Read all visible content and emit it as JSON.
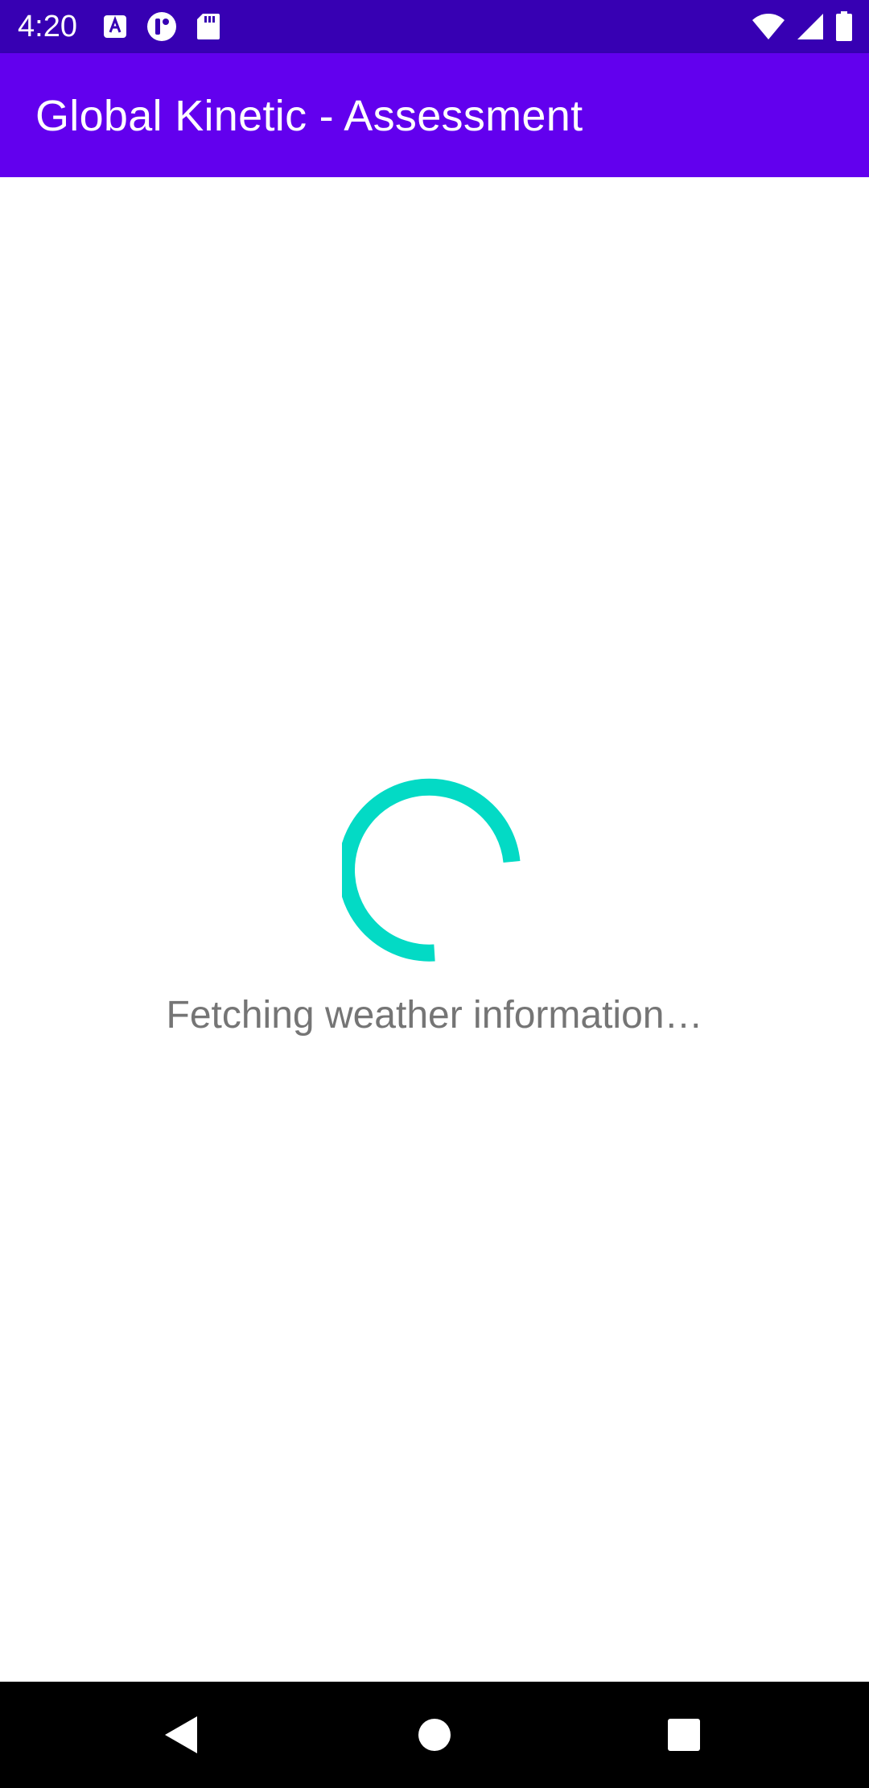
{
  "status_bar": {
    "time": "4:20",
    "left_icons": [
      "text-a-icon",
      "t-badge-icon",
      "sd-card-icon"
    ],
    "right_icons": [
      "wifi-icon",
      "cell-signal-icon",
      "battery-icon"
    ]
  },
  "app_bar": {
    "title": "Global Kinetic - Assessment"
  },
  "content": {
    "loading_text": "Fetching weather information…"
  },
  "nav_bar": {
    "buttons": [
      "back-icon",
      "home-icon",
      "recents-icon"
    ]
  },
  "colors": {
    "status_bar": "#3700b3",
    "app_bar": "#6200ee",
    "spinner": "#03dac5",
    "loading_text": "#757575",
    "nav_bar": "#000000"
  }
}
